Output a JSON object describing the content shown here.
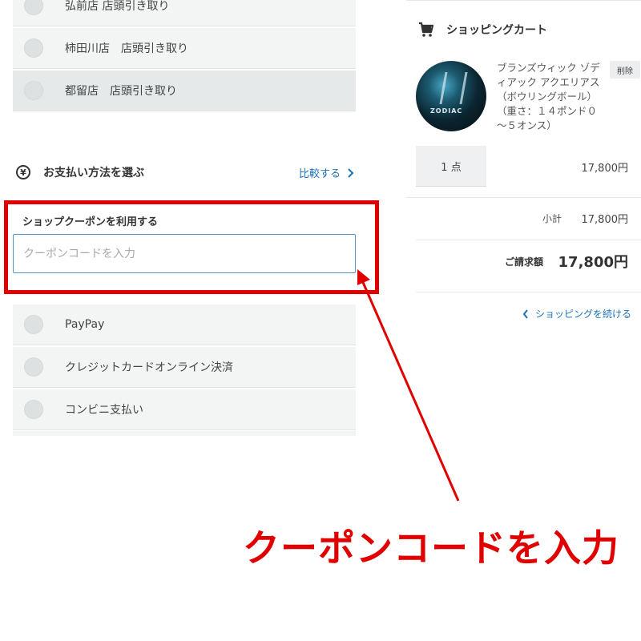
{
  "pickup_options": [
    {
      "label": "弘前店 店頭引き取り"
    },
    {
      "label": "柿田川店　店頭引き取り"
    },
    {
      "label": "都留店　店頭引き取り"
    }
  ],
  "payment": {
    "title": "お支払い方法を選ぶ",
    "compare_link": "比較する",
    "coupon_label": "ショップクーポンを利用する",
    "coupon_placeholder": "クーポンコードを入力",
    "coupon_value": "",
    "methods": [
      {
        "label": "PayPay"
      },
      {
        "label": "クレジットカードオンライン決済"
      },
      {
        "label": "コンビニ支払い"
      }
    ]
  },
  "cart": {
    "title": "ショッピングカート",
    "item": {
      "name": "ブランズウィック ゾディアック アクエリアス（ボウリングボール）（重さ：１４ポンド０～５オンス）",
      "image_text": "ZODIAC",
      "delete_label": "削除",
      "quantity": "1 点",
      "price": "17,800円"
    },
    "subtotal_label": "小計",
    "subtotal_value": "17,800円",
    "total_label": "ご請求額",
    "total_value": "17,800円",
    "continue_link": "ショッピングを続ける"
  },
  "annotation": {
    "text": "クーポンコードを入力",
    "color": "#e00000"
  },
  "icons": {
    "cart": "cart-icon",
    "yen": "yen-circle-icon",
    "chevron_right": "chevron-right-icon",
    "chevron_left": "chevron-left-icon"
  }
}
